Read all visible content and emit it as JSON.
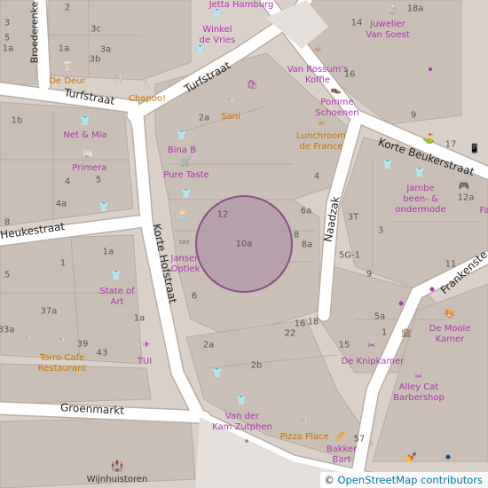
{
  "colors": {
    "background": "#d9d0c9",
    "building": "#c9bfb6",
    "road": "#ffffff",
    "road_casing": "#b7aea7",
    "shop": "#ac39ac",
    "food": "#c77400",
    "marker_fill": "#ad8fa8",
    "marker_stroke": "#8a4f86"
  },
  "streets": {
    "turfstraat_1": "Turfstraat",
    "turfstraat_2": "Turfstraat",
    "heukestraat": "Heukestraat",
    "korte_hofstraat": "Korte Hofstraat",
    "naadzak": "Naadzak",
    "korte_beukerstraat": "Korte Beukerstraat",
    "frankensteeg": "Frankenste",
    "groenmarkt": "Groenmarkt",
    "broederenkerk": "Broederenke"
  },
  "pois": {
    "jetta": "Jetta Hamburg",
    "winkel": [
      "Winkel",
      "de Vries"
    ],
    "juwelier": [
      "Juwelier",
      "Van Soest"
    ],
    "vanrossum": [
      "Van Rossum's",
      "Koffie"
    ],
    "pomme": [
      "Pomme",
      "Schoenen"
    ],
    "lunchroom": [
      "Lunchroom",
      "de France"
    ],
    "dedeur": "De Deur",
    "chapoo": "Chapoo!",
    "sani": "Sani",
    "netmia": "Net & Mia",
    "primera": "Primera",
    "binab": "Bina B",
    "puretaste": "Pure Taste",
    "jambe": [
      "Jambe",
      "been- &",
      "ondermode"
    ],
    "jansen": [
      "Jansen",
      "Optiek"
    ],
    "stateofart": [
      "State of",
      "Art"
    ],
    "torro": [
      "Torro Cafe",
      "Restaurant"
    ],
    "tui": "TUI",
    "demooie": [
      "De Mooie",
      "Kamer"
    ],
    "knipkamer": "De Knipkamer",
    "alleycat": [
      "Alley Cat",
      "Barbershop"
    ],
    "vanderkam": [
      "Van der",
      "Kam Zutphen"
    ],
    "pizzaplace": "Pizza Place",
    "bakkerbart": [
      "Bakker",
      "Bart"
    ],
    "wijnhuis": "Wijnhuistoren",
    "fa": "Fa"
  },
  "house_numbers": {
    "n2": "2",
    "n3": "3",
    "n5": "5",
    "n1a_a": "1a",
    "n1a_b": "1a",
    "n3c": "3c",
    "n3a": "3a",
    "n3b": "3b",
    "n14": "14",
    "n18a": "18a",
    "n16": "16",
    "n9": "9",
    "n17": "17",
    "n2a": "2a",
    "n1b": "1b",
    "n4": "4",
    "n5b": "5",
    "n4a": "4a",
    "n8": "8",
    "n12": "12",
    "n10a": "10a",
    "n6a": "6a",
    "n3T": "3T",
    "n3r": "3",
    "n8r": "8",
    "n8a": "8a",
    "n5G1": "5G-1",
    "n9r": "9",
    "n11": "11",
    "n1": "1",
    "n5c": "5",
    "n37a": "37a",
    "n33a": "33a",
    "n1a_c": "1a",
    "n1a_d": "1a",
    "n39": "39",
    "n43": "43",
    "n6": "6",
    "n2a_b": "2a",
    "n2b": "2b",
    "n16b": "16",
    "n18": "18",
    "n22": "22",
    "n15": "15",
    "n5a": "5a",
    "n12a": "12a",
    "n57": "57",
    "n1r": "1"
  },
  "attribution": {
    "prefix": "© ",
    "link": "OpenStreetMap contributors"
  }
}
